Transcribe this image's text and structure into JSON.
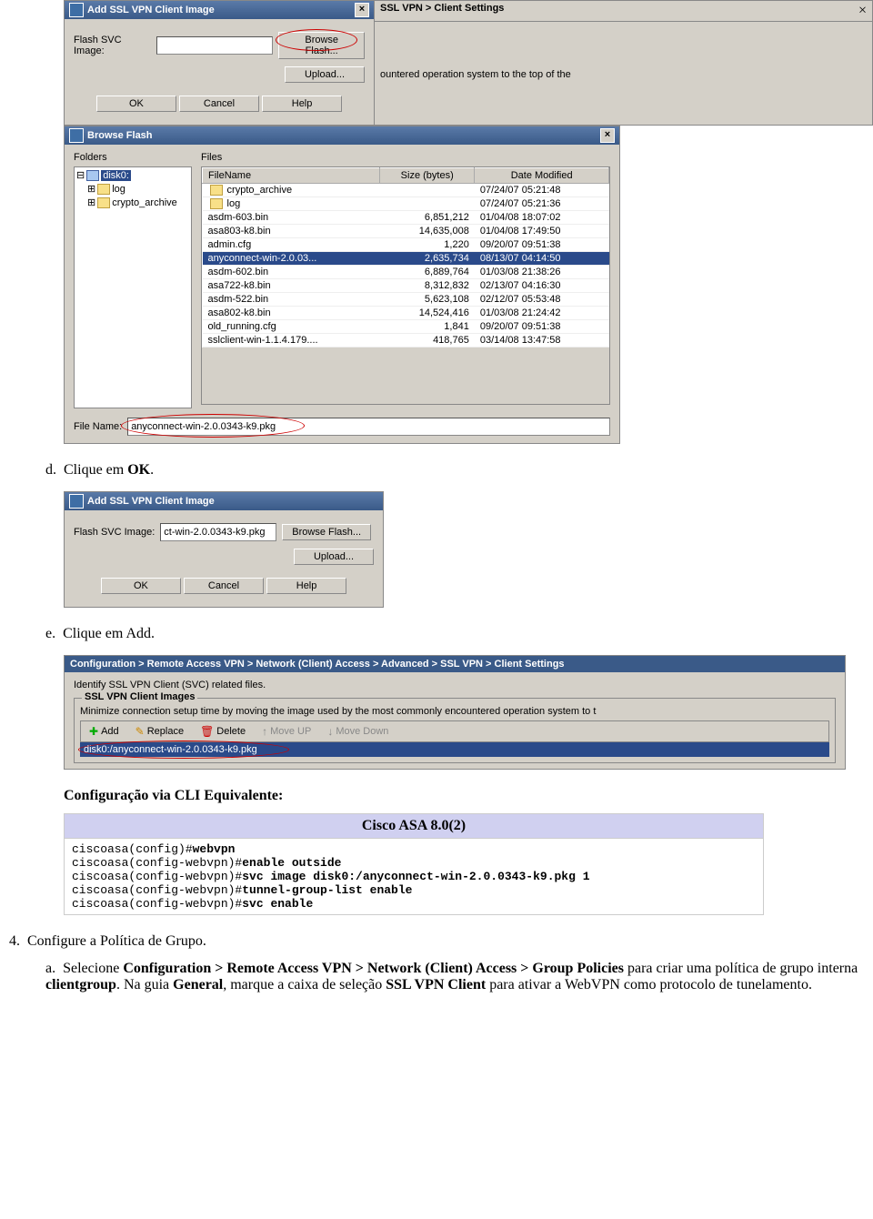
{
  "dlg1": {
    "title": "Add SSL VPN Client Image",
    "sidelabel": "SSL VPN > Client Settings",
    "flash_label": "Flash SVC Image:",
    "flash_value": "",
    "browse": "Browse Flash...",
    "upload": "Upload...",
    "ok": "OK",
    "cancel": "Cancel",
    "help": "Help",
    "sidehint": "ountered operation system to the top of the"
  },
  "browse": {
    "title": "Browse Flash",
    "folders": "Folders",
    "files": "Files",
    "tree": {
      "root": "disk0:",
      "c1": "log",
      "c2": "crypto_archive"
    },
    "cols": {
      "name": "FileName",
      "size": "Size (bytes)",
      "date": "Date Modified"
    },
    "rows": [
      {
        "name": "crypto_archive",
        "size": "",
        "date": "07/24/07 05:21:48",
        "folder": true
      },
      {
        "name": "log",
        "size": "",
        "date": "07/24/07 05:21:36",
        "folder": true
      },
      {
        "name": "asdm-603.bin",
        "size": "6,851,212",
        "date": "01/04/08 18:07:02"
      },
      {
        "name": "asa803-k8.bin",
        "size": "14,635,008",
        "date": "01/04/08 17:49:50"
      },
      {
        "name": "admin.cfg",
        "size": "1,220",
        "date": "09/20/07 09:51:38"
      },
      {
        "name": "anyconnect-win-2.0.03...",
        "size": "2,635,734",
        "date": "08/13/07 04:14:50",
        "sel": true
      },
      {
        "name": "asdm-602.bin",
        "size": "6,889,764",
        "date": "01/03/08 21:38:26"
      },
      {
        "name": "asa722-k8.bin",
        "size": "8,312,832",
        "date": "02/13/07 04:16:30"
      },
      {
        "name": "asdm-522.bin",
        "size": "5,623,108",
        "date": "02/12/07 05:53:48"
      },
      {
        "name": "asa802-k8.bin",
        "size": "14,524,416",
        "date": "01/03/08 21:24:42"
      },
      {
        "name": "old_running.cfg",
        "size": "1,841",
        "date": "09/20/07 09:51:38"
      },
      {
        "name": "sslclient-win-1.1.4.179....",
        "size": "418,765",
        "date": "03/14/08 13:47:58"
      }
    ],
    "filename_label": "File Name:",
    "filename_value": "anyconnect-win-2.0.0343-k9.pkg"
  },
  "step_d": {
    "marker": "d.",
    "pre": "Clique em ",
    "bold": "OK",
    "post": "."
  },
  "dlg2": {
    "title": "Add SSL VPN Client Image",
    "flash_label": "Flash SVC Image:",
    "flash_value": "ct-win-2.0.0343-k9.pkg",
    "browse": "Browse Flash...",
    "upload": "Upload...",
    "ok": "OK",
    "cancel": "Cancel",
    "help": "Help"
  },
  "step_e": {
    "marker": "e.",
    "text": "Clique em Add."
  },
  "cfg": {
    "breadcrumb": "Configuration > Remote Access VPN > Network (Client) Access > Advanced > SSL VPN > Client Settings",
    "identify": "Identify SSL VPN Client (SVC) related files.",
    "group": "SSL VPN Client Images",
    "hint": "Minimize connection setup time by moving the image used by the most commonly encountered operation system to t",
    "add": "Add",
    "replace": "Replace",
    "delete": "Delete",
    "up": "Move UP",
    "down": "Move Down",
    "row": "disk0:/anyconnect-win-2.0.0343-k9.pkg"
  },
  "cli": {
    "heading": "Configuração via CLI Equivalente:",
    "title": "Cisco ASA 8.0(2)",
    "l1p": "ciscoasa(config)#",
    "l1b": "webvpn",
    "l2p": "ciscoasa(config-webvpn)#",
    "l2b": "enable outside",
    "l3p": "ciscoasa(config-webvpn)#",
    "l3b": "svc image disk0:/anyconnect-win-2.0.0343-k9.pkg 1",
    "l4p": "ciscoasa(config-webvpn)#",
    "l4b": "tunnel-group-list enable",
    "l5p": "ciscoasa(config-webvpn)#",
    "l5b": "svc enable"
  },
  "step4": {
    "marker": "4.",
    "text": "Configure a Política de Grupo."
  },
  "step4a": {
    "marker": "a.",
    "t1": "Selecione ",
    "b1": "Configuration > Remote Access VPN > Network (Client) Access > Group Policies",
    "t2": " para criar uma política de grupo interna ",
    "b2": "clientgroup",
    "t3": ". Na guia ",
    "b3": "General",
    "t4": ", marque a caixa de seleção ",
    "b4": "SSL VPN Client",
    "t5": " para ativar a WebVPN como protocolo de tunelamento."
  }
}
